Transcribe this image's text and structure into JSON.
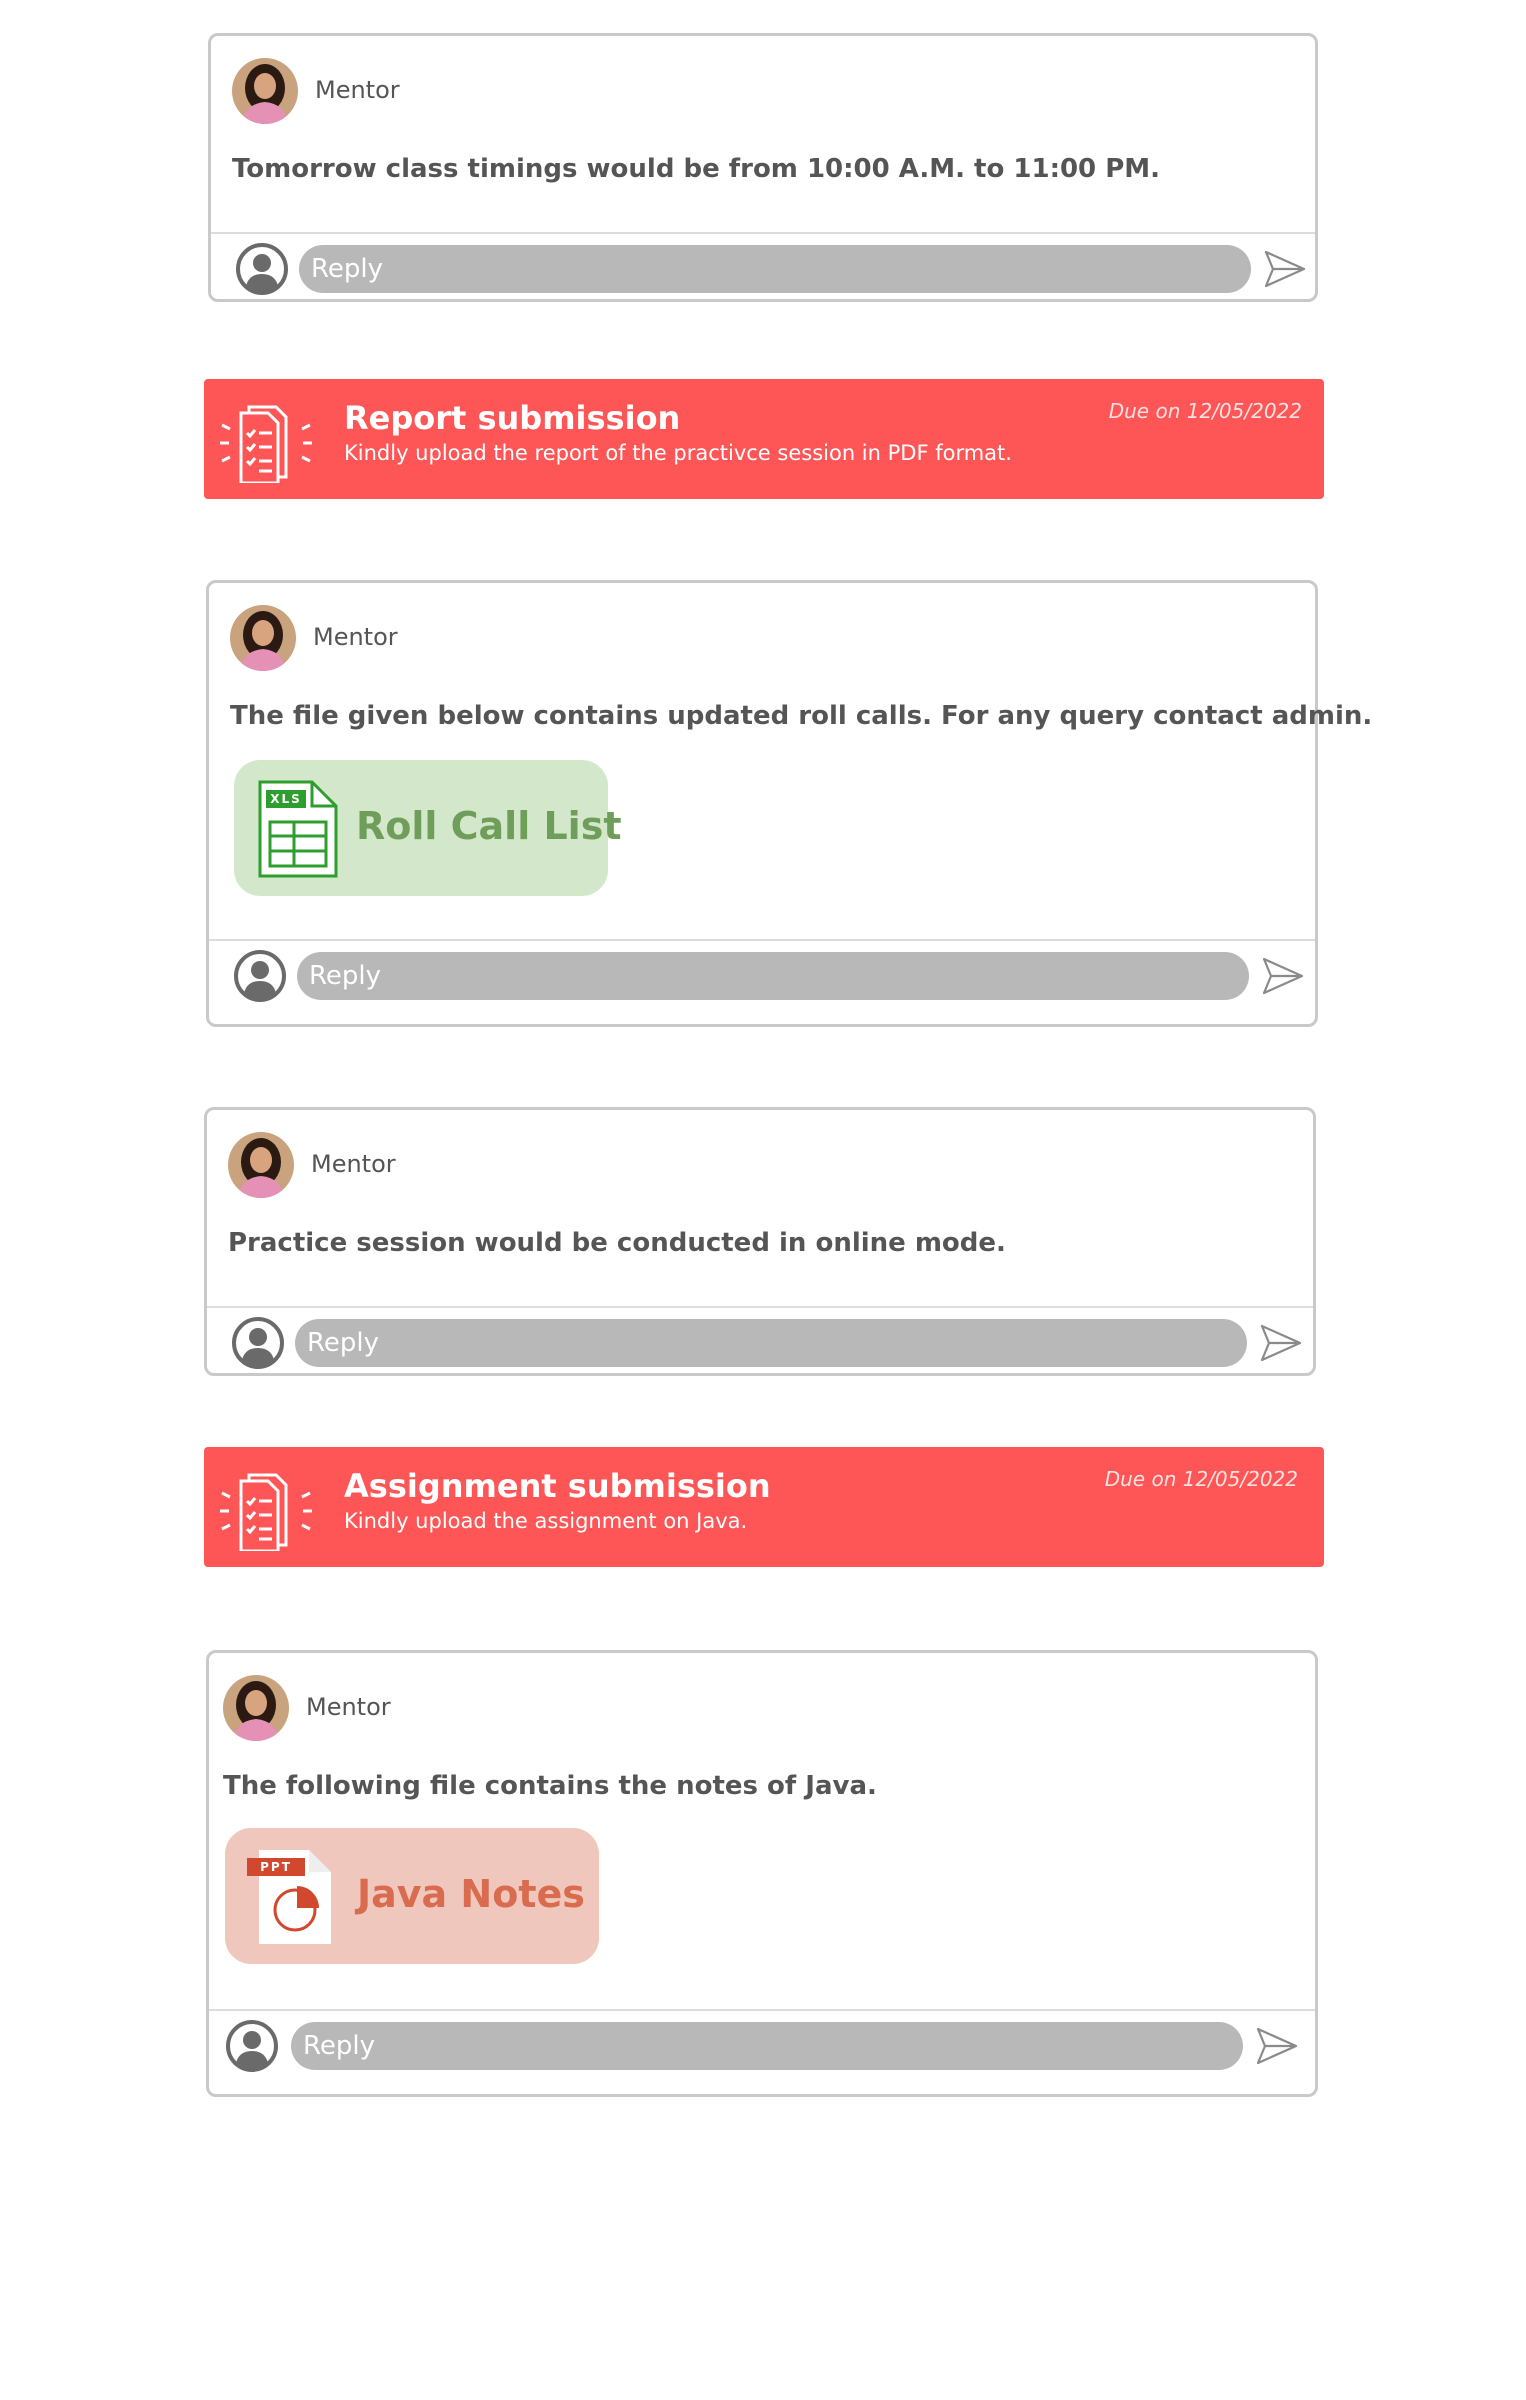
{
  "posts": [
    {
      "author": "Mentor",
      "message": "Tomorrow class timings would be from 10:00 A.M. to 11:00 PM.",
      "reply_placeholder": "Reply"
    },
    {
      "author": "Mentor",
      "message": "The file given below contains updated roll calls. For any query contact admin.",
      "attachment": {
        "type_badge": "XLS",
        "label": "Roll Call List",
        "color": "#6f9e5a"
      },
      "reply_placeholder": "Reply"
    },
    {
      "author": "Mentor",
      "message": "Practice session would be conducted in online mode.",
      "reply_placeholder": "Reply"
    },
    {
      "author": "Mentor",
      "message": "The following file contains the notes of Java.",
      "attachment": {
        "type_badge": "PPT",
        "label": "Java Notes",
        "color": "#d96b4e"
      },
      "reply_placeholder": "Reply"
    }
  ],
  "tasks": [
    {
      "title": "Report submission",
      "description": "Kindly upload the report of the practivce session in PDF format.",
      "due": "Due on 12/05/2022"
    },
    {
      "title": "Assignment submission",
      "description": "Kindly upload the assignment on Java.",
      "due": "Due on 12/05/2022"
    }
  ],
  "colors": {
    "banner": "#fe5656",
    "reply_bar": "#b8b8b8",
    "card_border": "#c9c9c9"
  },
  "icons": [
    "mentor-avatar",
    "user-icon",
    "send-icon",
    "checklist-icon",
    "xls-file-icon",
    "ppt-file-icon"
  ]
}
